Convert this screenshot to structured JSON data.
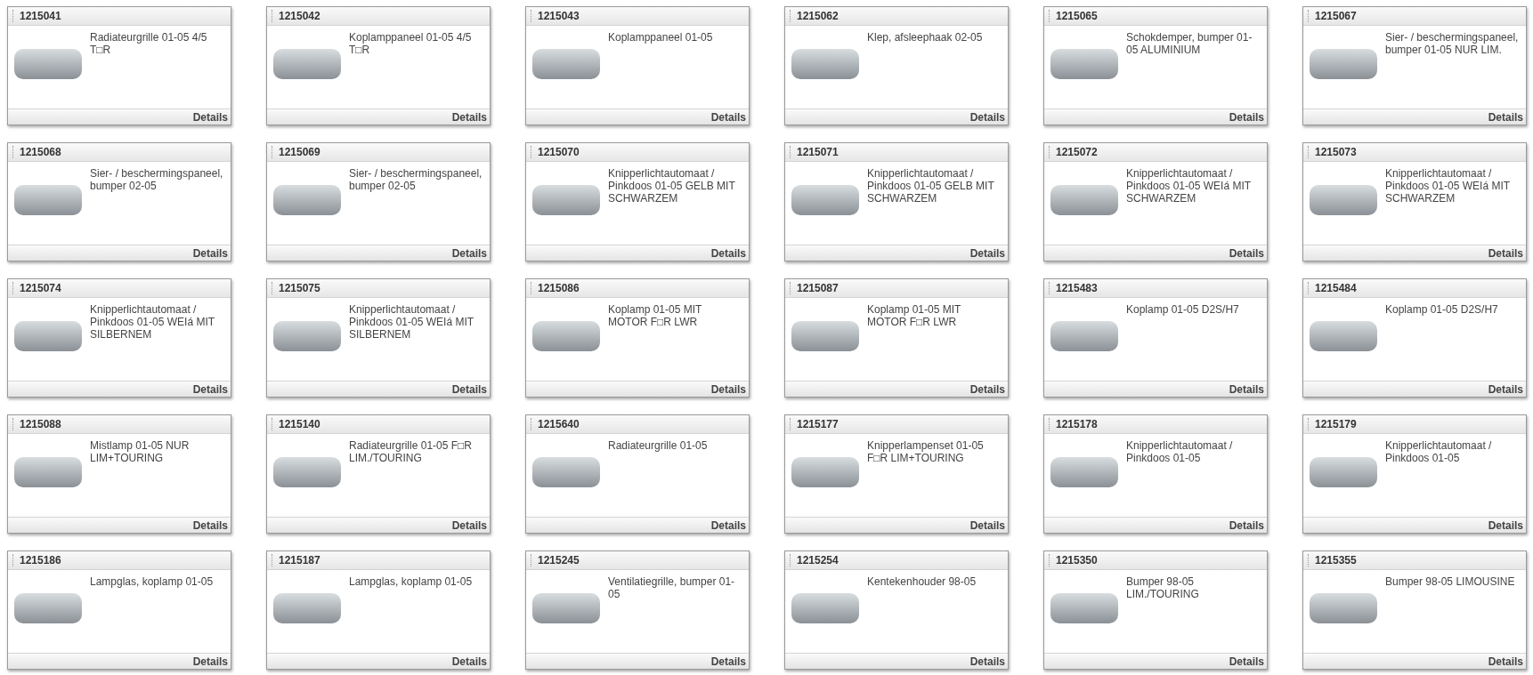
{
  "products": [
    {
      "code": "1215041",
      "description": "Radiateurgrille 01-05 4/5 T□R",
      "link": "Details"
    },
    {
      "code": "1215042",
      "description": "Koplamppaneel 01-05 4/5 T□R",
      "link": "Details"
    },
    {
      "code": "1215043",
      "description": "Koplamppaneel 01-05",
      "link": "Details"
    },
    {
      "code": "1215062",
      "description": "Klep, afsleephaak 02-05",
      "link": "Details"
    },
    {
      "code": "1215065",
      "description": "Schokdemper, bumper 01-05 ALUMINIUM",
      "link": "Details"
    },
    {
      "code": "1215067",
      "description": "Sier- / beschermingspaneel, bumper 01-05 NUR LIM.",
      "link": "Details"
    },
    {
      "code": "1215068",
      "description": "Sier- / beschermingspaneel, bumper 02-05",
      "link": "Details"
    },
    {
      "code": "1215069",
      "description": "Sier- / beschermingspaneel, bumper 02-05",
      "link": "Details"
    },
    {
      "code": "1215070",
      "description": "Knipperlichtautomaat / Pinkdoos 01-05 GELB MIT SCHWARZEM",
      "link": "Details"
    },
    {
      "code": "1215071",
      "description": "Knipperlichtautomaat / Pinkdoos 01-05 GELB MIT SCHWARZEM",
      "link": "Details"
    },
    {
      "code": "1215072",
      "description": "Knipperlichtautomaat / Pinkdoos 01-05 WEIá MIT SCHWARZEM",
      "link": "Details"
    },
    {
      "code": "1215073",
      "description": "Knipperlichtautomaat / Pinkdoos 01-05 WEIá MIT SCHWARZEM",
      "link": "Details"
    },
    {
      "code": "1215074",
      "description": "Knipperlichtautomaat / Pinkdoos 01-05 WEIá MIT SILBERNEM",
      "link": "Details"
    },
    {
      "code": "1215075",
      "description": "Knipperlichtautomaat / Pinkdoos 01-05 WEIá MIT SILBERNEM",
      "link": "Details"
    },
    {
      "code": "1215086",
      "description": "Koplamp 01-05 MIT MOTOR F□R LWR",
      "link": "Details"
    },
    {
      "code": "1215087",
      "description": "Koplamp 01-05 MIT MOTOR F□R LWR",
      "link": "Details"
    },
    {
      "code": "1215483",
      "description": "Koplamp 01-05 D2S/H7",
      "link": "Details"
    },
    {
      "code": "1215484",
      "description": "Koplamp 01-05 D2S/H7",
      "link": "Details"
    },
    {
      "code": "1215088",
      "description": "Mistlamp 01-05 NUR LIM+TOURING",
      "link": "Details"
    },
    {
      "code": "1215140",
      "description": "Radiateurgrille 01-05 F□R LIM./TOURING",
      "link": "Details"
    },
    {
      "code": "1215640",
      "description": "Radiateurgrille 01-05",
      "link": "Details"
    },
    {
      "code": "1215177",
      "description": "Knipperlampenset 01-05 F□R LIM+TOURING",
      "link": "Details"
    },
    {
      "code": "1215178",
      "description": "Knipperlichtautomaat / Pinkdoos 01-05",
      "link": "Details"
    },
    {
      "code": "1215179",
      "description": "Knipperlichtautomaat / Pinkdoos 01-05",
      "link": "Details"
    },
    {
      "code": "1215186",
      "description": "Lampglas, koplamp 01-05",
      "link": "Details"
    },
    {
      "code": "1215187",
      "description": "Lampglas, koplamp 01-05",
      "link": "Details"
    },
    {
      "code": "1215245",
      "description": "Ventilatiegrille, bumper 01-05",
      "link": "Details"
    },
    {
      "code": "1215254",
      "description": "Kentekenhouder 98-05",
      "link": "Details"
    },
    {
      "code": "1215350",
      "description": "Bumper 98-05 LIM./TOURING",
      "link": "Details"
    },
    {
      "code": "1215355",
      "description": "Bumper 98-05 LIMOUSINE",
      "link": "Details"
    }
  ]
}
